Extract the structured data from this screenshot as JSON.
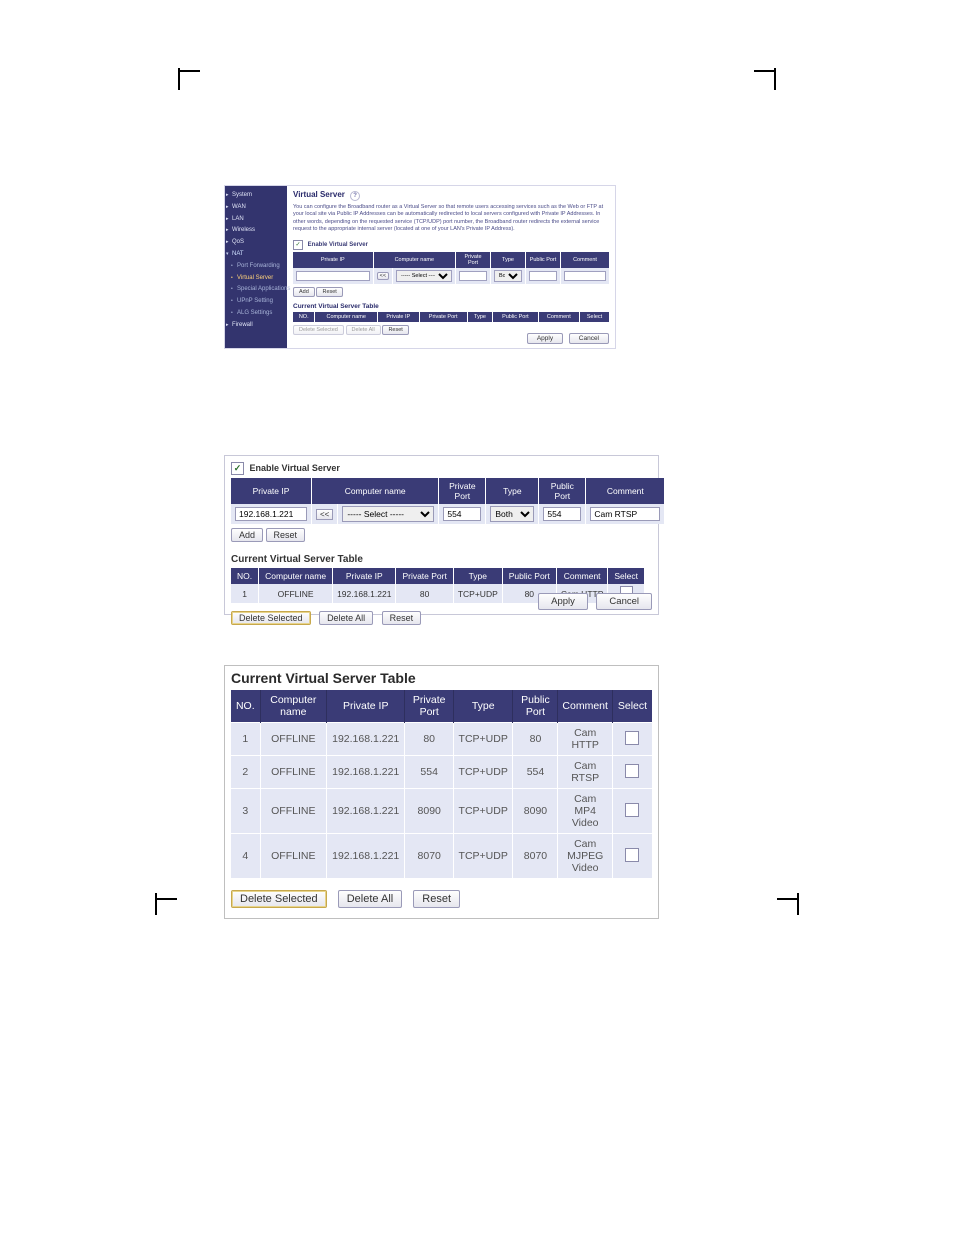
{
  "panel1": {
    "sidebar": [
      {
        "label": "System"
      },
      {
        "label": "WAN"
      },
      {
        "label": "LAN"
      },
      {
        "label": "Wireless"
      },
      {
        "label": "QoS"
      },
      {
        "label": "NAT",
        "selected": true,
        "sub": [
          {
            "label": "Port Forwarding"
          },
          {
            "label": "Virtual Server",
            "active": true
          },
          {
            "label": "Special Applications"
          },
          {
            "label": "UPnP Setting"
          },
          {
            "label": "ALG Settings"
          }
        ]
      },
      {
        "label": "Firewall"
      }
    ],
    "title": "Virtual Server",
    "desc": "You can configure the Broadband router as a Virtual Server so that remote users accessing services such as the Web or FTP at your local site via Public IP Addresses can be automatically redirected to local servers configured with Private IP Addresses. In other words, depending on the requested service (TCP/UDP) port number, the Broadband router redirects the external service request to the appropriate internal server (located at one of your LAN's Private IP Address).",
    "enable_label": "Enable Virtual Server",
    "headers": {
      "private_ip": "Private IP",
      "computer_name": "Computer name",
      "private_port": "Private Port",
      "type": "Type",
      "public_port": "Public Port",
      "comment": "Comment",
      "no": "NO.",
      "select": "Select"
    },
    "select_placeholder": "----- Select -----",
    "type_default": "Both",
    "buttons": {
      "add": "Add",
      "reset": "Reset",
      "sel": "<<",
      "delete_selected": "Delete Selected",
      "delete_all": "Delete All",
      "apply": "Apply",
      "cancel": "Cancel"
    },
    "table_title": "Current Virtual Server Table"
  },
  "panel2": {
    "enable_label": "Enable Virtual Server",
    "headers": {
      "private_ip": "Private IP",
      "computer_name": "Computer name",
      "private_port": "Private Port",
      "type": "Type",
      "public_port": "Public Port",
      "comment": "Comment",
      "no": "NO.",
      "select": "Select"
    },
    "input": {
      "private_ip": "192.168.1.221",
      "computer_sel": "----- Select -----",
      "private_port": "554",
      "type": "Both",
      "public_port": "554",
      "comment": "Cam RTSP"
    },
    "table_title": "Current Virtual Server Table",
    "row": {
      "no": "1",
      "computer": "OFFLINE",
      "private_ip": "192.168.1.221",
      "private_port": "80",
      "type": "TCP+UDP",
      "public_port": "80",
      "comment": "Cam HTTP"
    },
    "buttons": {
      "add": "Add",
      "reset": "Reset",
      "sel": "<<",
      "delete_selected": "Delete Selected",
      "delete_all": "Delete All",
      "apply": "Apply",
      "cancel": "Cancel"
    }
  },
  "panel3": {
    "title": "Current Virtual Server Table",
    "headers": {
      "no": "NO.",
      "computer": "Computer name",
      "private_ip": "Private IP",
      "private_port": "Private Port",
      "type": "Type",
      "public_port": "Public Port",
      "comment": "Comment",
      "select": "Select"
    },
    "rows": [
      {
        "no": "1",
        "computer": "OFFLINE",
        "private_ip": "192.168.1.221",
        "private_port": "80",
        "type": "TCP+UDP",
        "public_port": "80",
        "comment": "Cam HTTP"
      },
      {
        "no": "2",
        "computer": "OFFLINE",
        "private_ip": "192.168.1.221",
        "private_port": "554",
        "type": "TCP+UDP",
        "public_port": "554",
        "comment": "Cam RTSP"
      },
      {
        "no": "3",
        "computer": "OFFLINE",
        "private_ip": "192.168.1.221",
        "private_port": "8090",
        "type": "TCP+UDP",
        "public_port": "8090",
        "comment": "Cam MP4 Video"
      },
      {
        "no": "4",
        "computer": "OFFLINE",
        "private_ip": "192.168.1.221",
        "private_port": "8070",
        "type": "TCP+UDP",
        "public_port": "8070",
        "comment": "Cam MJPEG Video"
      }
    ],
    "buttons": {
      "delete_selected": "Delete Selected",
      "delete_all": "Delete All",
      "reset": "Reset"
    }
  }
}
